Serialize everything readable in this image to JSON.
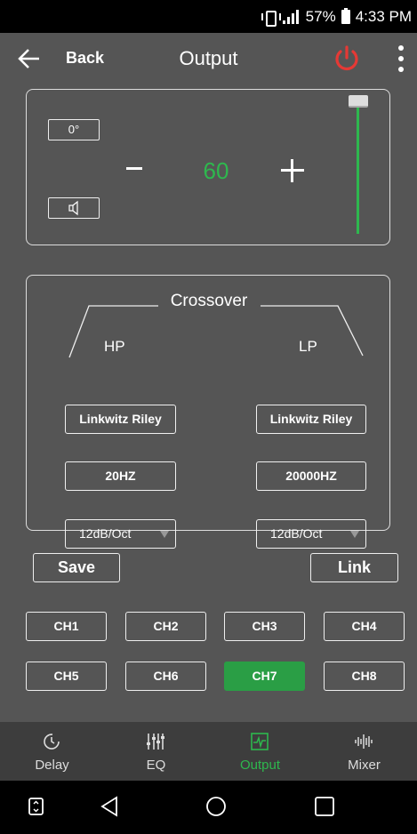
{
  "status_bar": {
    "battery": "57%",
    "time": "4:33 PM"
  },
  "header": {
    "back_label": "Back",
    "title": "Output",
    "icons": [
      "back-arrow-icon",
      "power-icon",
      "more-vert-icon"
    ],
    "power_color": "#e53935"
  },
  "gain_panel": {
    "phase_label": "0°",
    "gain_value": "60",
    "level_fraction": 1.0,
    "accent_color": "#2eb84e"
  },
  "crossover": {
    "title": "Crossover",
    "hp": {
      "label": "HP",
      "filter_type": "Linkwitz Riley",
      "frequency": "20HZ",
      "slope": "12dB/Oct"
    },
    "lp": {
      "label": "LP",
      "filter_type": "Linkwitz Riley",
      "frequency": "20000HZ",
      "slope": "12dB/Oct"
    }
  },
  "actions": {
    "save_label": "Save",
    "link_label": "Link"
  },
  "channels": [
    "CH1",
    "CH2",
    "CH3",
    "CH4",
    "CH5",
    "CH6",
    "CH7",
    "CH8"
  ],
  "active_channel": "CH7",
  "bottom_nav": [
    {
      "label": "Delay",
      "icon": "clock-icon"
    },
    {
      "label": "EQ",
      "icon": "eq-sliders-icon"
    },
    {
      "label": "Output",
      "icon": "output-waveform-icon",
      "active": true
    },
    {
      "label": "Mixer",
      "icon": "mixer-waveform-icon"
    }
  ]
}
